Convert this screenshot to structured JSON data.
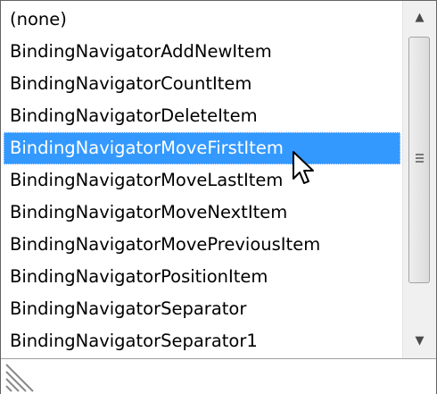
{
  "list": {
    "items": [
      {
        "label": "(none)",
        "selected": false
      },
      {
        "label": "BindingNavigatorAddNewItem",
        "selected": false
      },
      {
        "label": "BindingNavigatorCountItem",
        "selected": false
      },
      {
        "label": "BindingNavigatorDeleteItem",
        "selected": false
      },
      {
        "label": "BindingNavigatorMoveFirstItem",
        "selected": true
      },
      {
        "label": "BindingNavigatorMoveLastItem",
        "selected": false
      },
      {
        "label": "BindingNavigatorMoveNextItem",
        "selected": false
      },
      {
        "label": "BindingNavigatorMovePreviousItem",
        "selected": false
      },
      {
        "label": "BindingNavigatorPositionItem",
        "selected": false
      },
      {
        "label": "BindingNavigatorSeparator",
        "selected": false
      },
      {
        "label": "BindingNavigatorSeparator1",
        "selected": false
      }
    ]
  },
  "scrollbar": {
    "up_arrow": "▲",
    "down_arrow": "▼",
    "up_icon": "scroll-up-arrow-icon",
    "down_icon": "scroll-down-arrow-icon"
  },
  "colors": {
    "selection_background": "#3399ff",
    "selection_text": "#ffffff",
    "border": "#646464"
  },
  "icons": {
    "resize_grip": "resize-grip-icon",
    "cursor": "mouse-pointer-icon"
  }
}
